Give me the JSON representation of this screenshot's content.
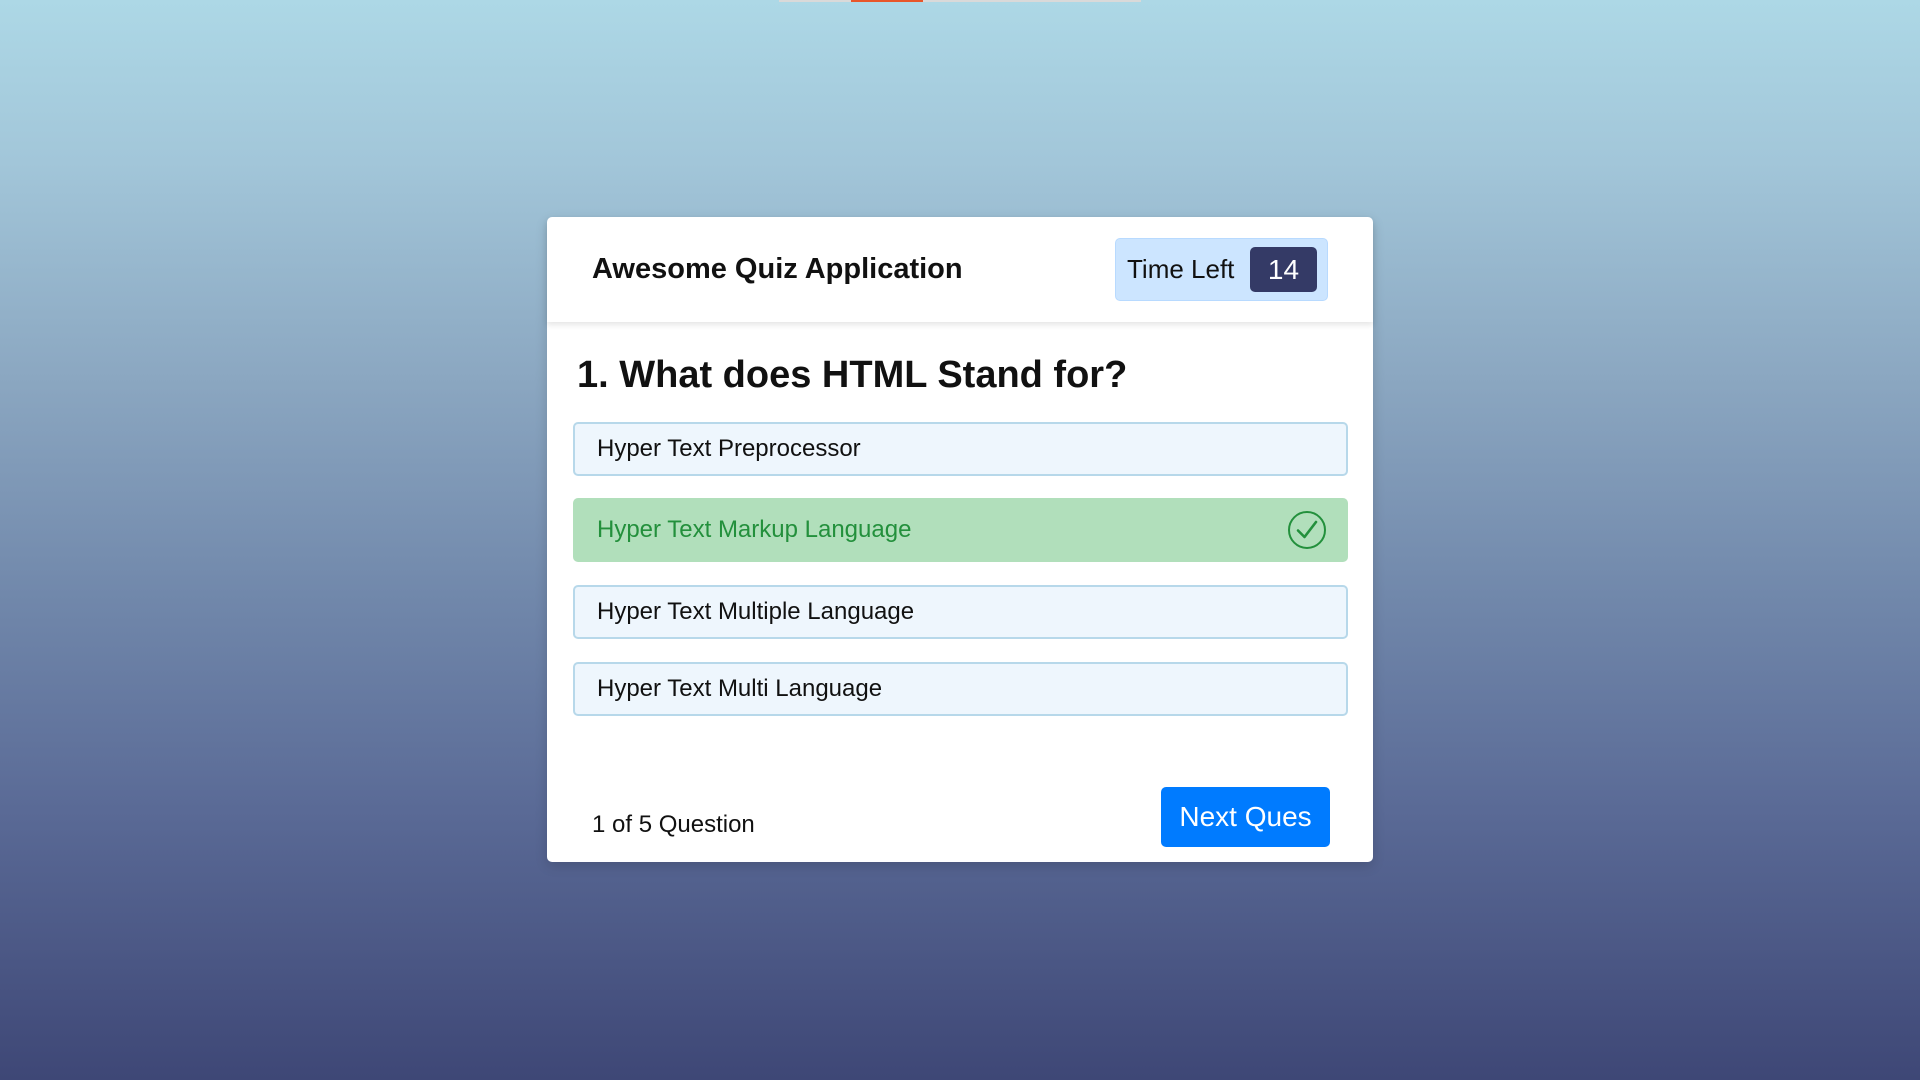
{
  "progress": {
    "fraction": 0.2
  },
  "header": {
    "title": "Awesome Quiz Application",
    "timer_label": "Time Left",
    "timer_value": "14"
  },
  "question": {
    "text": "1. What does HTML Stand for?",
    "options": [
      {
        "label": "Hyper Text Preprocessor",
        "state": "default"
      },
      {
        "label": "Hyper Text Markup Language",
        "state": "correct",
        "icon": "check-circle-icon"
      },
      {
        "label": "Hyper Text Multiple Language",
        "state": "default"
      },
      {
        "label": "Hyper Text Multi Language",
        "state": "default"
      }
    ]
  },
  "footer": {
    "count_text": "1 of 5 Question",
    "next_label": "Next Ques"
  },
  "colors": {
    "correct_bg": "#b1dfbb",
    "correct_text": "#23903c",
    "accent": "#007bff",
    "timer_badge": "#343a66",
    "progress_fill": "#e8562a"
  }
}
